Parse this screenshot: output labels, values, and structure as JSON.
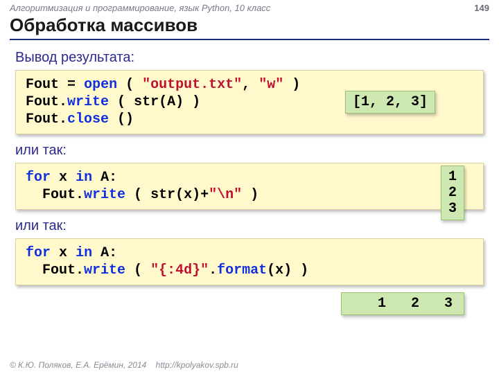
{
  "header": {
    "course": "Алгоритмизация и программирование, язык Python, 10 класс",
    "page": "149"
  },
  "title": "Обработка массивов",
  "sections": {
    "s1_label": "Вывод результата:",
    "s2_label": "или так:",
    "s3_label": "или так:"
  },
  "code1": {
    "l1a": "Fout",
    "l1b": "=",
    "l1c": "open",
    "l1d": "(",
    "l1e": "\"output.txt\"",
    "l1f": ",",
    "l1g": "\"w\"",
    "l1h": ")",
    "l2a": "Fout.",
    "l2b": "write",
    "l2c": "(",
    "l2d": "str(A)",
    "l2e": ")",
    "l3a": "Fout.",
    "l3b": "close",
    "l3c": "()"
  },
  "out1": "[1, 2, 3]",
  "code2": {
    "l1a": "for",
    "l1b": "x",
    "l1c": "in",
    "l1d": "A:",
    "l2a": "  Fout.",
    "l2b": "write",
    "l2c": "(",
    "l2d": "str(x)",
    "l2e": "+",
    "l2f": "\"\\n\"",
    "l2g": ")"
  },
  "out2": "1\n2\n3",
  "code3": {
    "l1a": "for",
    "l1b": "x",
    "l1c": "in",
    "l1d": "A:",
    "l2a": "  Fout.",
    "l2b": "write",
    "l2c": "(",
    "l2d": "\"{:4d}\"",
    "l2e": ".",
    "l2f": "format",
    "l2g": "(x)",
    "l2h": ")"
  },
  "out3": "   1   2   3",
  "footer": {
    "copyright": "© К.Ю. Поляков, Е.А. Ерёмин, 2014",
    "url": "http://kpolyakov.spb.ru"
  }
}
